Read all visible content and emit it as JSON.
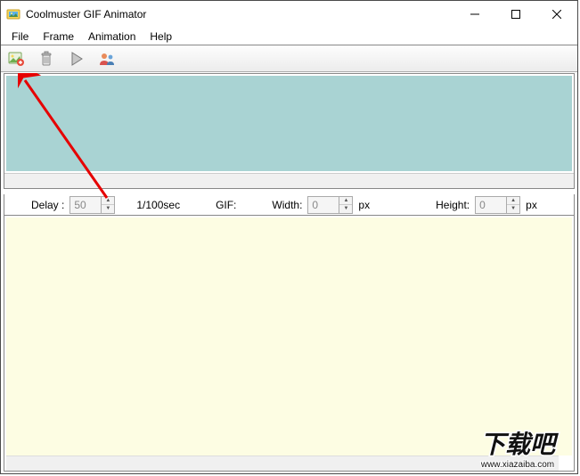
{
  "window": {
    "title": "Coolmuster GIF Animator"
  },
  "menu": {
    "file": "File",
    "frame": "Frame",
    "animation": "Animation",
    "help": "Help"
  },
  "toolbar": {
    "add_frame": "add-frame",
    "delete_frame": "delete-frame",
    "play": "play",
    "users": "users"
  },
  "controls": {
    "delay_label": "Delay :",
    "delay_value": "50",
    "delay_unit": "1/100sec",
    "gif_label": "GIF:",
    "width_label": "Width:",
    "width_value": "0",
    "width_unit": "px",
    "height_label": "Height:",
    "height_value": "0",
    "height_unit": "px"
  },
  "watermark": {
    "text": "下载吧",
    "url": "www.xiazaiba.com"
  }
}
